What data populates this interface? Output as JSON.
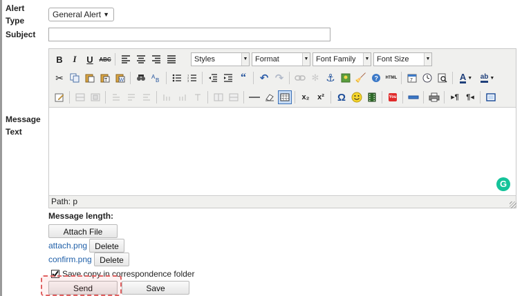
{
  "labels": {
    "alert_type_line1": "Alert",
    "alert_type_line2": "Type",
    "subject": "Subject",
    "message_line1": "Message",
    "message_line2": "Text"
  },
  "alert_type": {
    "selected": "General Alert"
  },
  "subject": {
    "value": ""
  },
  "editor": {
    "combos": {
      "styles": "Styles",
      "format": "Format",
      "font_family": "Font Family",
      "font_size": "Font Size"
    },
    "text_buttons": {
      "bold": "B",
      "italic": "I",
      "underline": "U",
      "strike": "ABC",
      "html": "HTML",
      "blockquote": "“",
      "omega": "Ω",
      "font_color": "A",
      "highlight": "ab",
      "subscript": "x₂",
      "superscript": "x²",
      "ltr": "¶",
      "rtl": "¶",
      "youtube": "You"
    },
    "path_label": "Path: p",
    "grammarly": "G"
  },
  "message_length": {
    "label": "Message length:"
  },
  "attachments": {
    "attach_button": "Attach File",
    "files": [
      {
        "name": "attach.png",
        "delete_label": "Delete"
      },
      {
        "name": "confirm.png",
        "delete_label": "Delete"
      }
    ]
  },
  "save_copy": {
    "label": "Save copy in correspondence folder",
    "checked": true
  },
  "actions": {
    "send": "Send",
    "save": "Save"
  },
  "colors": {
    "toolbar_bg": "#f0f0ee",
    "link": "#1f5fa8",
    "highlight_border": "#e06060",
    "selected_button": "#c6dbf4"
  }
}
